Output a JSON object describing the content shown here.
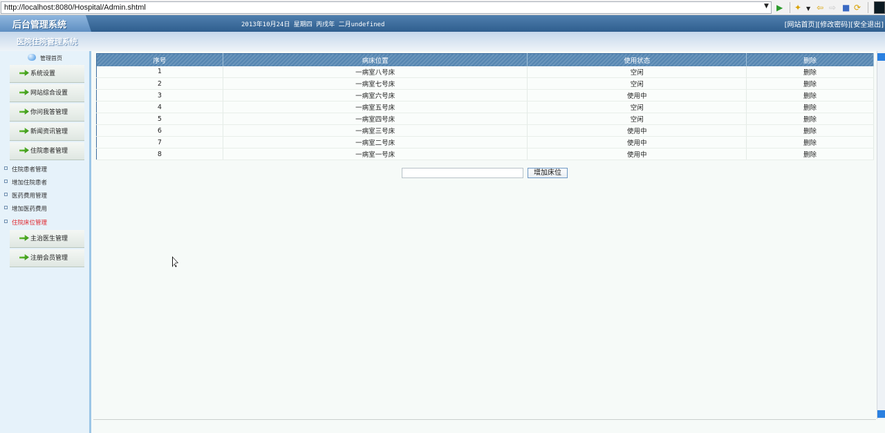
{
  "browser": {
    "url": "http://localhost:8080/Hospital/Admin.shtml"
  },
  "header": {
    "logo": "后台管理系统",
    "date": "2013年10月24日 星期四 丙戌年 二月undefined",
    "links": [
      "[网站首页]",
      "[修改密码]",
      "[安全退出]"
    ],
    "system_title": "医院住院管理系统"
  },
  "sidebar": {
    "home": "管理首页",
    "menu": [
      "系统设置",
      "网站综合设置",
      "你问我答管理",
      "新闻资讯管理",
      "住院患者管理"
    ],
    "submenu": [
      {
        "label": "住院患者管理",
        "active": false
      },
      {
        "label": "增加住院患者",
        "active": false
      },
      {
        "label": "医药费用管理",
        "active": false
      },
      {
        "label": "增加医药费用",
        "active": false
      },
      {
        "label": "住院床位管理",
        "active": true
      }
    ],
    "menu_after": [
      "主治医生管理",
      "注册会员管理"
    ]
  },
  "table": {
    "headers": [
      "序号",
      "病床位置",
      "使用状态",
      "删除"
    ],
    "rows": [
      [
        "1",
        "一病室八号床",
        "空闲",
        "删除"
      ],
      [
        "2",
        "一病室七号床",
        "空闲",
        "删除"
      ],
      [
        "3",
        "一病室六号床",
        "使用中",
        "删除"
      ],
      [
        "4",
        "一病室五号床",
        "空闲",
        "删除"
      ],
      [
        "5",
        "一病室四号床",
        "空闲",
        "删除"
      ],
      [
        "6",
        "一病室三号床",
        "使用中",
        "删除"
      ],
      [
        "7",
        "一病室二号床",
        "使用中",
        "删除"
      ],
      [
        "8",
        "一病室一号床",
        "使用中",
        "删除"
      ]
    ]
  },
  "form": {
    "add_input_value": "",
    "add_button": "增加床位"
  },
  "colors": {
    "accent": "#2f5e8e",
    "active_menu": "#e0282f"
  }
}
